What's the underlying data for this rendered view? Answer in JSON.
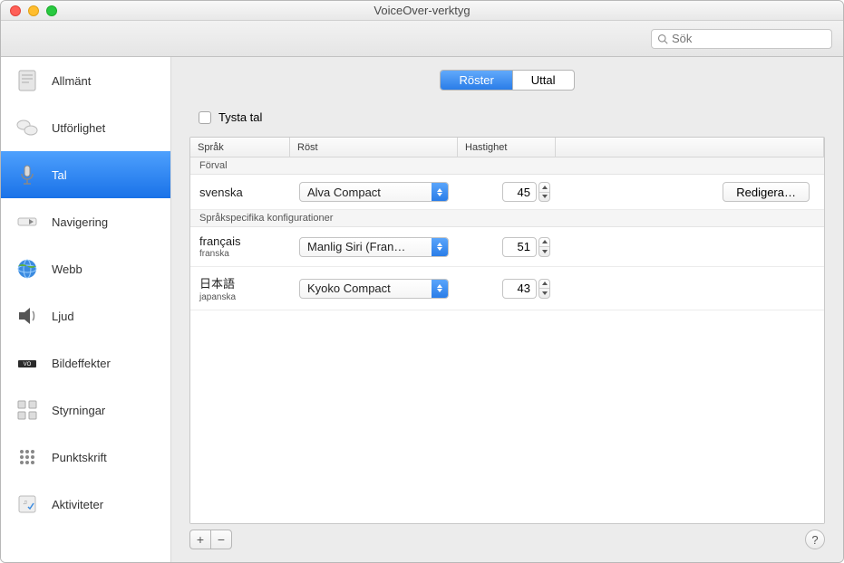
{
  "window": {
    "title": "VoiceOver-verktyg"
  },
  "search": {
    "placeholder": "Sök"
  },
  "sidebar": {
    "items": [
      {
        "label": "Allmänt"
      },
      {
        "label": "Utförlighet"
      },
      {
        "label": "Tal"
      },
      {
        "label": "Navigering"
      },
      {
        "label": "Webb"
      },
      {
        "label": "Ljud"
      },
      {
        "label": "Bildeffekter"
      },
      {
        "label": "Styrningar"
      },
      {
        "label": "Punktskrift"
      },
      {
        "label": "Aktiviteter"
      }
    ],
    "selected_index": 2
  },
  "tabs": {
    "items": [
      "Röster",
      "Uttal"
    ],
    "active_index": 0
  },
  "mute": {
    "label": "Tysta tal",
    "checked": false
  },
  "table": {
    "columns": {
      "lang": "Språk",
      "voice": "Röst",
      "speed": "Hastighet"
    },
    "sections": {
      "default": {
        "title": "Förval",
        "row": {
          "lang": "svenska",
          "voice": "Alva Compact",
          "speed": 45,
          "edit_label": "Redigera…"
        }
      },
      "specific": {
        "title": "Språkspecifika konfigurationer",
        "rows": [
          {
            "native": "français",
            "local": "franska",
            "voice": "Manlig Siri (Fran…",
            "speed": 51
          },
          {
            "native": "日本語",
            "local": "japanska",
            "voice": "Kyoko Compact",
            "speed": 43
          }
        ]
      }
    }
  },
  "footer": {
    "add": "+",
    "remove": "−",
    "help": "?"
  }
}
